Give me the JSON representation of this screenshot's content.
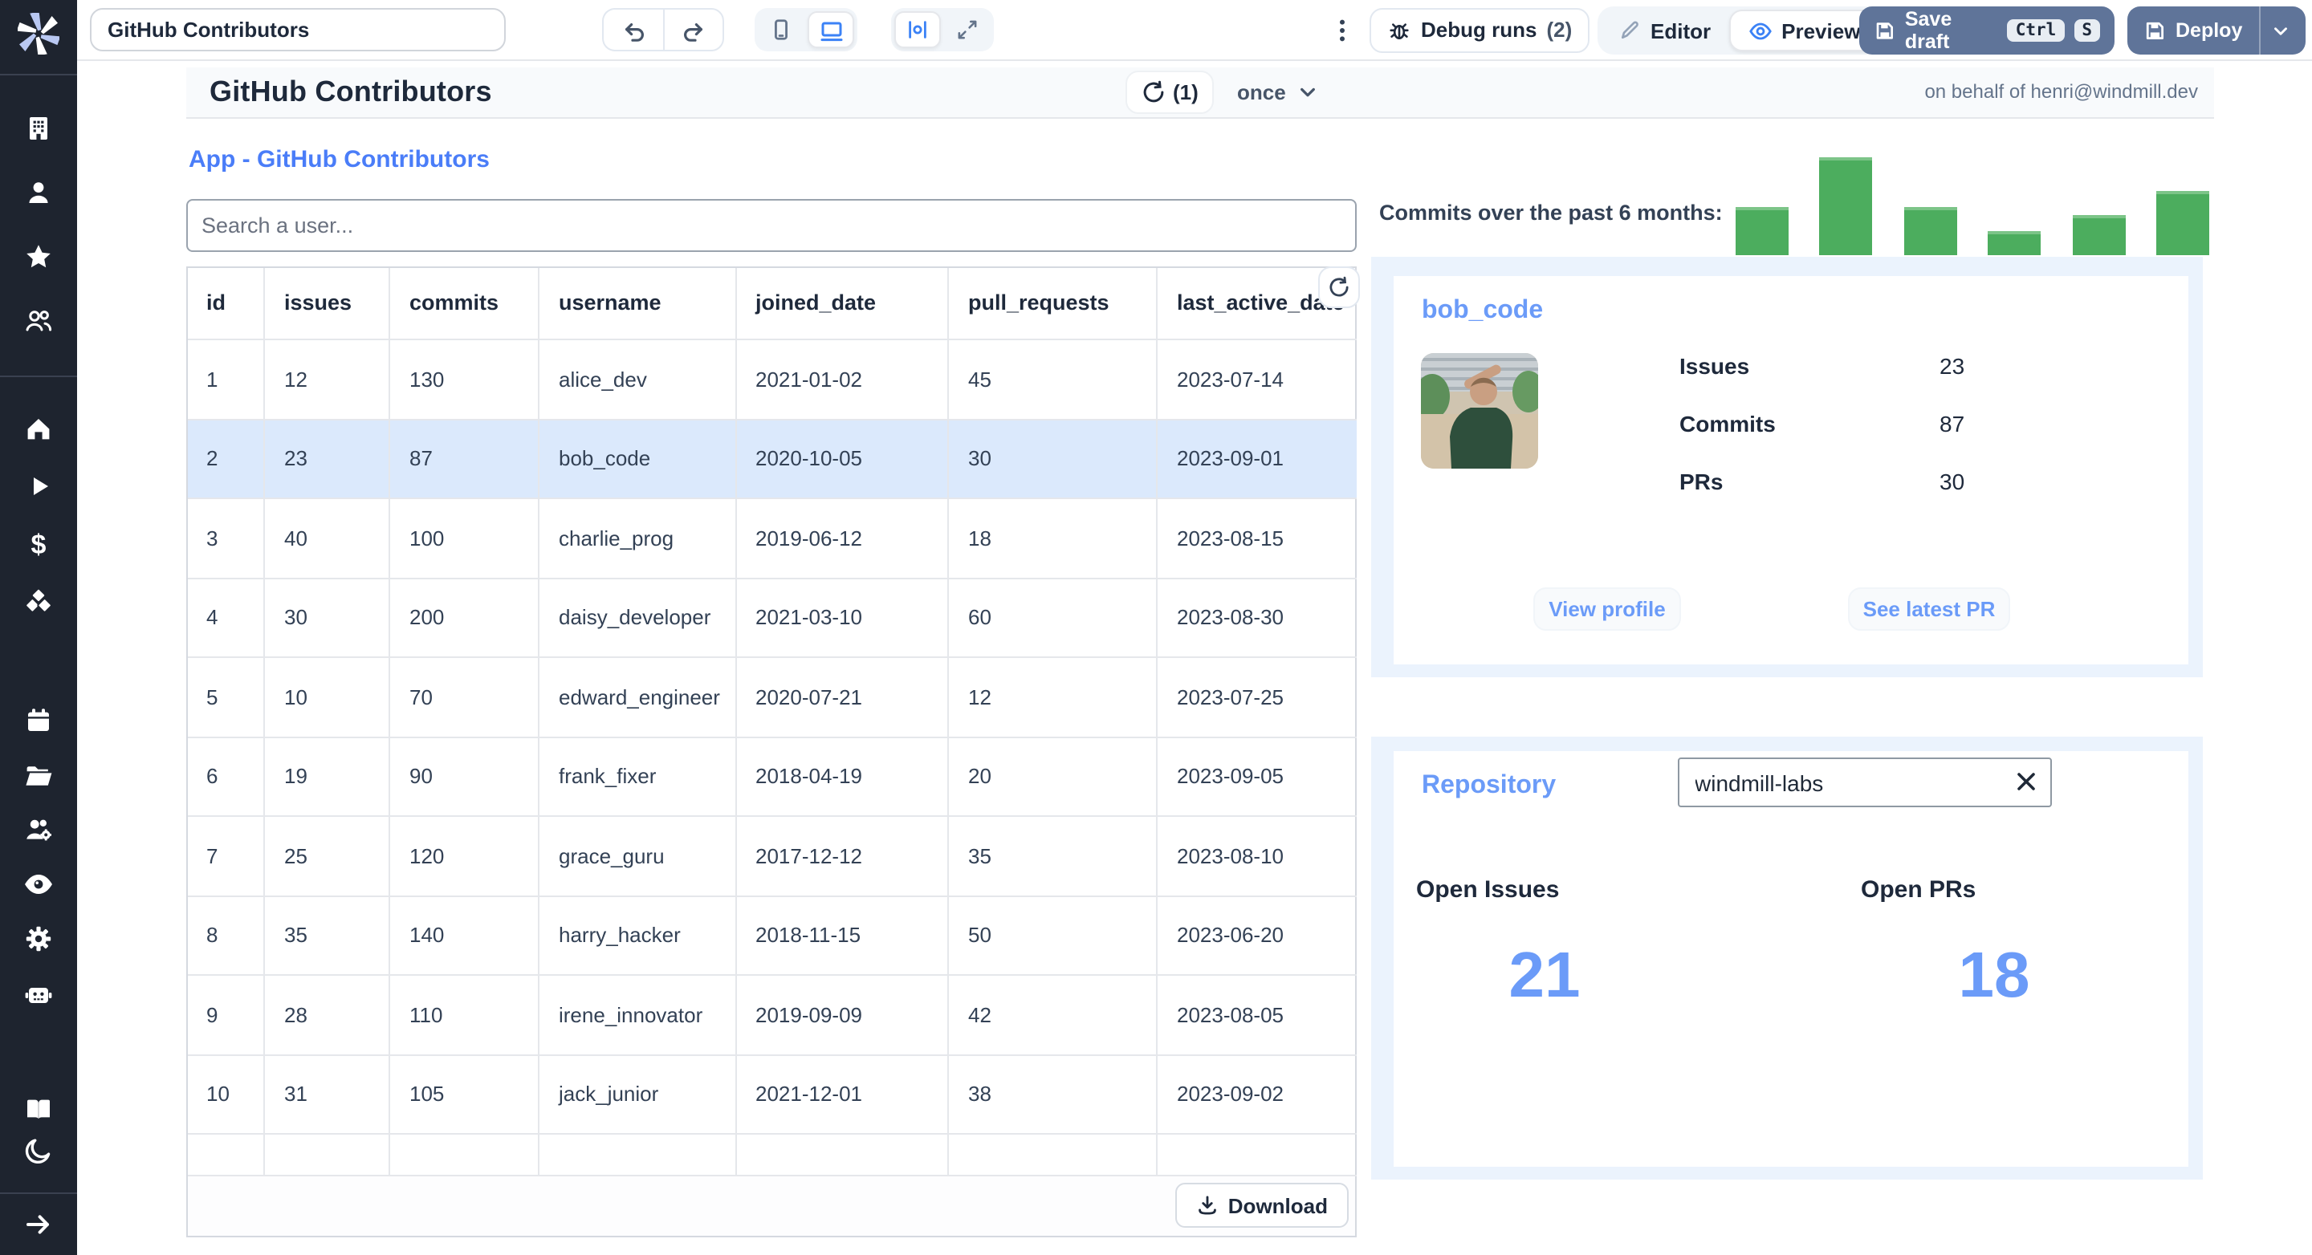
{
  "topbar": {
    "app_title_input": "GitHub Contributors",
    "debug_runs_label": "Debug runs",
    "debug_runs_count": "(2)",
    "editor_label": "Editor",
    "preview_label": "Preview",
    "save_draft_label": "Save draft",
    "kbd_ctrl": "Ctrl",
    "kbd_s": "S",
    "deploy_label": "Deploy"
  },
  "header": {
    "title": "GitHub Contributors",
    "refresh_count": "(1)",
    "schedule_label": "once",
    "on_behalf": "on behalf of henri@windmill.dev"
  },
  "app": {
    "link_title": "App - GitHub Contributors",
    "search_placeholder": "Search a user..."
  },
  "table": {
    "columns": [
      "id",
      "issues",
      "commits",
      "username",
      "joined_date",
      "pull_requests",
      "last_active_date"
    ],
    "rows": [
      [
        "1",
        "12",
        "130",
        "alice_dev",
        "2021-01-02",
        "45",
        "2023-07-14"
      ],
      [
        "2",
        "23",
        "87",
        "bob_code",
        "2020-10-05",
        "30",
        "2023-09-01"
      ],
      [
        "3",
        "40",
        "100",
        "charlie_prog",
        "2019-06-12",
        "18",
        "2023-08-15"
      ],
      [
        "4",
        "30",
        "200",
        "daisy_developer",
        "2021-03-10",
        "60",
        "2023-08-30"
      ],
      [
        "5",
        "10",
        "70",
        "edward_engineer",
        "2020-07-21",
        "12",
        "2023-07-25"
      ],
      [
        "6",
        "19",
        "90",
        "frank_fixer",
        "2018-04-19",
        "20",
        "2023-09-05"
      ],
      [
        "7",
        "25",
        "120",
        "grace_guru",
        "2017-12-12",
        "35",
        "2023-08-10"
      ],
      [
        "8",
        "35",
        "140",
        "harry_hacker",
        "2018-11-15",
        "50",
        "2023-06-20"
      ],
      [
        "9",
        "28",
        "110",
        "irene_innovator",
        "2019-09-09",
        "42",
        "2023-08-05"
      ],
      [
        "10",
        "31",
        "105",
        "jack_junior",
        "2021-12-01",
        "38",
        "2023-09-02"
      ]
    ],
    "selected_row_index": 1,
    "download_label": "Download"
  },
  "chart_data": {
    "type": "bar",
    "title": "Commits over the past 6 months:",
    "values": [
      49,
      100,
      49,
      25,
      41,
      66
    ],
    "ymax": 100,
    "bar_color": "#4cad5e",
    "xlabel": "",
    "ylabel": "",
    "legend": "none",
    "grid": false
  },
  "profile_card": {
    "title": "bob_code",
    "stats": [
      {
        "label": "Issues",
        "value": "23"
      },
      {
        "label": "Commits",
        "value": "87"
      },
      {
        "label": "PRs",
        "value": "30"
      }
    ],
    "view_profile_label": "View profile",
    "see_latest_pr_label": "See latest PR"
  },
  "repo_card": {
    "title": "Repository",
    "input_value": "windmill-labs",
    "open_issues_label": "Open Issues",
    "open_prs_label": "Open PRs",
    "open_issues": "21",
    "open_prs": "18"
  },
  "sidebar": {
    "icons": [
      "windmill-logo",
      "building",
      "user",
      "star",
      "users",
      "home",
      "play",
      "dollar",
      "cubes",
      "calendar",
      "folder-open",
      "user-group-gear",
      "eye",
      "gear",
      "robot",
      "book",
      "moon",
      "arrow-right"
    ]
  },
  "colors": {
    "sidebar_bg": "#1e242f",
    "accent_blue": "#4a7df8",
    "light_blue": "#6b9bf8",
    "icon_blue": "#3b82f6",
    "button_slate": "#5f7499",
    "panel_blue": "#ebf3fd",
    "selected_row": "#dbe9fc",
    "bar_green": "#4cad5e"
  }
}
